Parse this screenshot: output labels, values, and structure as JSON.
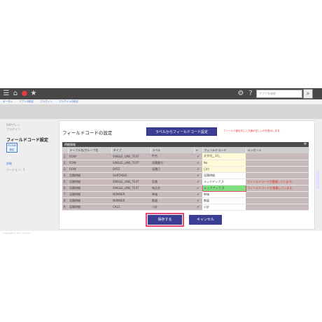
{
  "topbar": {
    "menu_icon": "☰",
    "home_icon": "⌂",
    "bell_icon": "●",
    "star_icon": "★",
    "gear_icon": "⚙",
    "help_icon": "?",
    "search_placeholder": "アプリを検索",
    "search_button_icon": "⌕"
  },
  "breadcrumb": [
    "ポータル",
    "アプリの設定",
    "プラグイン",
    "プラグインの設定"
  ],
  "sidebar": {
    "plugin_small": "SAPプレー\nプラグイン",
    "title": "フィールドコード設定",
    "badge": "FCODE\n設定",
    "details": "詳細",
    "version": "バージョン：1"
  },
  "main": {
    "page_title": "フィールドコードの設定",
    "label_button": "ラベルからフィールドコード設定",
    "warning_note": "フィールド値を元に入力値が正しいかを表示します。",
    "section_title": "明細情報",
    "section_icon": "✲",
    "columns": [
      "",
      "テーブル名/グループ名",
      "タイプ",
      "ラベル",
      "≡",
      "フィールドコード",
      "メッセージ"
    ],
    "rows": [
      {
        "no": "1",
        "group": "ROW",
        "type": "SINGLE_LINE_TEXT",
        "label": "件名",
        "check": "✔",
        "code": "文字列__1行_",
        "message": ""
      },
      {
        "no": "2",
        "group": "ROW",
        "type": "SINGLE_LINE_TEXT",
        "label": "見積番号",
        "check": "✔",
        "code": "No",
        "message": ""
      },
      {
        "no": "3",
        "group": "ROW",
        "type": "DATE",
        "label": "見積日",
        "check": "✔",
        "code": "日付",
        "message": ""
      },
      {
        "no": "4",
        "group": "見積明細",
        "type": "SUBTABLE",
        "label": "",
        "check": "✔",
        "code": "見積明細",
        "message": ""
      },
      {
        "no": "5",
        "group": "見積明細",
        "type": "SINGLE_LINE_TEXT",
        "label": "型番",
        "check": "✔",
        "code": "ルックアップ_0",
        "message": "フィールドコードが重複しています。"
      },
      {
        "no": "6",
        "group": "見積明細",
        "type": "SINGLE_LINE_TEXT",
        "label": "商品名",
        "check": "✔",
        "code": "ルックアップ_0",
        "message": "フィールドコードが重複しています。"
      },
      {
        "no": "7",
        "group": "見積明細",
        "type": "NUMBER",
        "label": "単価",
        "check": "✔",
        "code": "単価",
        "message": ""
      },
      {
        "no": "8",
        "group": "見積明細",
        "type": "NUMBER",
        "label": "数量",
        "check": "✔",
        "code": "数量",
        "message": ""
      },
      {
        "no": "9",
        "group": "見積明細",
        "type": "CALC",
        "label": "小計",
        "check": "✔",
        "code": "小計",
        "message": ""
      }
    ],
    "save_button": "保存する",
    "cancel_button": "キャンセル"
  },
  "footer": "Copyright © 2012 Cybozu",
  "colors": {
    "accent": "#3b3f94",
    "highlight_border": "#e8457a",
    "error_text": "#d33333"
  }
}
